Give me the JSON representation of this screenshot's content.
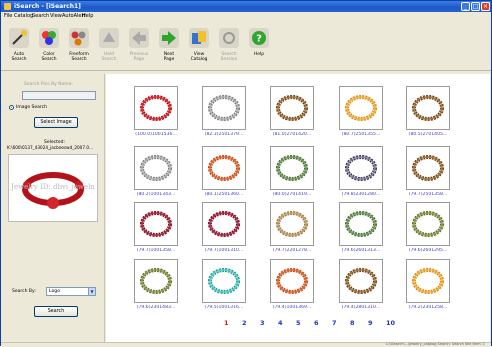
{
  "window": {
    "title": "iSearch - [iSearch1]"
  },
  "menu": [
    "File",
    "Catalog",
    "Search",
    "View",
    "AutoAlert",
    "Help"
  ],
  "toolbar": [
    {
      "label": "Auto\nSearch",
      "icon": "magic-wand-icon",
      "enabled": true
    },
    {
      "label": "Color\nSearch",
      "icon": "color-palette-icon",
      "enabled": true
    },
    {
      "label": "Freeform\nSearch",
      "icon": "freeform-icon",
      "enabled": true
    },
    {
      "label": "Hold\nSearch",
      "icon": "hold-icon",
      "enabled": false
    },
    {
      "label": "Previous\nPage",
      "icon": "arrow-left-icon",
      "enabled": false
    },
    {
      "label": "Next\nPage",
      "icon": "arrow-right-icon",
      "enabled": true
    },
    {
      "label": "View\nCatalog",
      "icon": "catalog-icon",
      "enabled": true
    },
    {
      "label": "Search\nSession",
      "icon": "session-icon",
      "enabled": false
    },
    {
      "label": "Help",
      "icon": "help-icon",
      "enabled": true
    }
  ],
  "left_panel": {
    "search_by_name_label": "Search Pics By Name:",
    "search_by_name_value": "",
    "image_search_label": "Image Search",
    "select_image_label": "Select Image",
    "selected_label": "Selected:",
    "selected_path": "K:\\600\\0137_43024_jacbeeswd_2007.0...",
    "preview_watermark": "Jewelry ID: dbvi_jeweln",
    "search_by_label": "Search By:",
    "search_by_value": "Logo",
    "search_button": "Search"
  },
  "results": [
    {
      "caption": "(100.0)1001536...",
      "tone": "red"
    },
    {
      "caption": "(82.3)2501379...",
      "tone": "grey"
    },
    {
      "caption": "(81.0)2701420...",
      "tone": "brown"
    },
    {
      "caption": "(80.7)2501355...",
      "tone": "amber"
    },
    {
      "caption": "(80.5)2701405...",
      "tone": "brown"
    },
    {
      "caption": "(80.2)1001343...",
      "tone": "grey"
    },
    {
      "caption": "(80.1)2501360...",
      "tone": "orange"
    },
    {
      "caption": "(80.0)2701419...",
      "tone": "green"
    },
    {
      "caption": "(79.8)2301280...",
      "tone": "dark"
    },
    {
      "caption": "(79.7)2501358...",
      "tone": "brown"
    },
    {
      "caption": "(79.7)1001358...",
      "tone": "wine"
    },
    {
      "caption": "(79.7)1001310...",
      "tone": "wine"
    },
    {
      "caption": "(79.7)2201278...",
      "tone": "tan"
    },
    {
      "caption": "(79.6)2601313...",
      "tone": "green"
    },
    {
      "caption": "(79.6)2601295...",
      "tone": "olive"
    },
    {
      "caption": "(79.6)2301483...",
      "tone": "olive"
    },
    {
      "caption": "(79.5)1001316...",
      "tone": "teal"
    },
    {
      "caption": "(79.4)1001369...",
      "tone": "orange"
    },
    {
      "caption": "(79.4)2801310...",
      "tone": "brown"
    },
    {
      "caption": "(79.2)2301258...",
      "tone": "amber"
    }
  ],
  "pager": {
    "pages": [
      "1",
      "2",
      "3",
      "4",
      "5",
      "6",
      "7",
      "8",
      "9",
      "10"
    ],
    "current": "1"
  },
  "status": {
    "text": "C:\\iSearch\\...\\jewelry_catalog  Search: Search Idle    Item: 1"
  },
  "colors": {
    "titlebar": "#1b58c8",
    "link": "#3c3cc8",
    "current_page": "#d11111"
  }
}
